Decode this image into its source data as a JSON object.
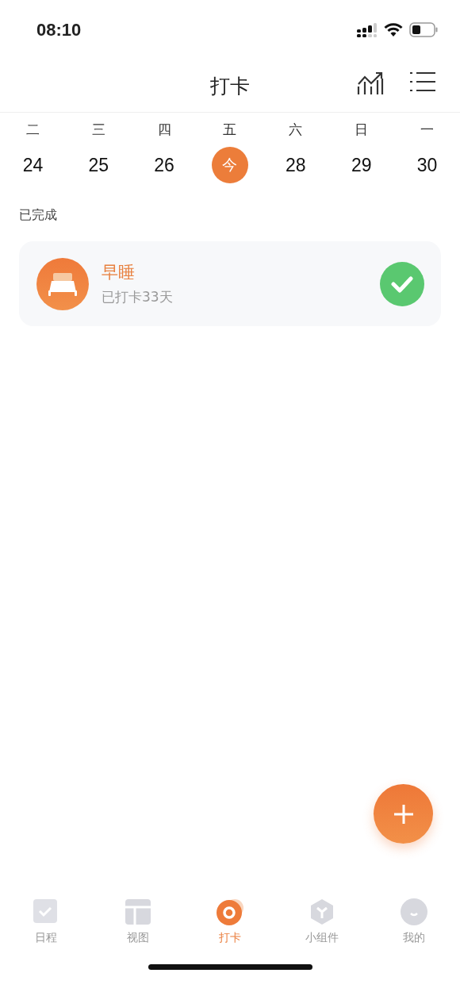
{
  "status_bar": {
    "time": "08:10"
  },
  "header": {
    "title": "打卡"
  },
  "week": [
    {
      "weekday": "二",
      "date": "24",
      "selected": false
    },
    {
      "weekday": "三",
      "date": "25",
      "selected": false
    },
    {
      "weekday": "四",
      "date": "26",
      "selected": false
    },
    {
      "weekday": "五",
      "date": "今",
      "selected": true
    },
    {
      "weekday": "六",
      "date": "28",
      "selected": false
    },
    {
      "weekday": "日",
      "date": "29",
      "selected": false
    },
    {
      "weekday": "一",
      "date": "30",
      "selected": false
    }
  ],
  "section": {
    "title": "已完成"
  },
  "habits": [
    {
      "name": "早睡",
      "streak": "已打卡33天",
      "done": true
    }
  ],
  "tab_bar": [
    {
      "label": "日程",
      "kind": "schedule",
      "selected": false
    },
    {
      "label": "视图",
      "kind": "view",
      "selected": false
    },
    {
      "label": "打卡",
      "kind": "checkin",
      "selected": true
    },
    {
      "label": "小组件",
      "kind": "widget",
      "selected": false
    },
    {
      "label": "我的",
      "kind": "me",
      "selected": false
    }
  ]
}
